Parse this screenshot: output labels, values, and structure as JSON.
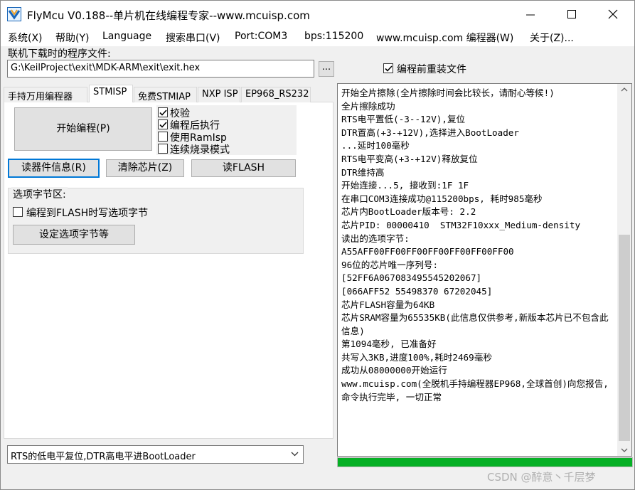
{
  "window": {
    "title": "FlyMcu V0.188--单片机在线编程专家--www.mcuisp.com",
    "icon": "flymcu-app-icon",
    "controls": [
      "minimize-icon",
      "maximize-icon",
      "close-icon"
    ]
  },
  "menu": [
    "系统(X)",
    "帮助(Y)",
    "Language",
    "搜索串口(V)",
    "Port:COM3",
    "bps:115200",
    "www.mcuisp.com 编程器(W)",
    "关于(Z)..."
  ],
  "program_file": {
    "label": "联机下载时的程序文件:",
    "path": "G:\\KeilProject\\exit\\MDK-ARM\\exit\\exit.hex",
    "browse_label": "...",
    "reload_label": "编程前重装文件",
    "reload_checked": true
  },
  "tabs": [
    "手持万用编程器",
    "STMISP",
    "免费STMIAP",
    "NXP ISP",
    "EP968_RS232"
  ],
  "active_tab": "STMISP",
  "stmisp": {
    "start_button": "开始编程(P)",
    "options": [
      {
        "label": "校验",
        "checked": true
      },
      {
        "label": "编程后执行",
        "checked": true
      },
      {
        "label": "使用RamIsp",
        "checked": false
      },
      {
        "label": "连续烧录模式",
        "checked": false
      }
    ],
    "read_info_button": "读器件信息(R)",
    "erase_button": "清除芯片(Z)",
    "read_flash_button": "读FLASH",
    "option_group_title": "选项字节区:",
    "flash_option_label": "编程到FLASH时写选项字节",
    "flash_option_checked": false,
    "set_option_button": "设定选项字节等"
  },
  "reset_mode": {
    "selected": "RTS的低电平复位,DTR高电平进BootLoader"
  },
  "log_lines": [
    "开始全片擦除(全片擦除时间会比较长，请耐心等候!)",
    "全片擦除成功",
    "RTS电平置低(-3--12V),复位",
    "DTR置高(+3-+12V),选择进入BootLoader",
    "...延时100毫秒",
    "RTS电平变高(+3-+12V)释放复位",
    "DTR维持高",
    "开始连接...5, 接收到:1F 1F",
    "在串口COM3连接成功@115200bps, 耗时985毫秒",
    "芯片内BootLoader版本号: 2.2",
    "芯片PID: 00000410  STM32F10xxx_Medium-density",
    "读出的选项字节:",
    "A55AFF00FF00FF00FF00FF00FF00FF00",
    "96位的芯片唯一序列号:",
    "[52FF6A067083495545202067]",
    "[066AFF52 55498370 67202045]",
    "芯片FLASH容量为64KB",
    "芯片SRAM容量为65535KB(此信息仅供参考,新版本芯片已不包含此信息)",
    "第1094毫秒, 已准备好",
    "共写入3KB,进度100%,耗时2469毫秒",
    "成功从08000000开始运行",
    "www.mcuisp.com(全脱机手持编程器EP968,全球首创)向您报告, 命令执行完毕, 一切正常"
  ],
  "progress": 1.0,
  "watermark": "CSDN @醉意丶千层梦",
  "colors": {
    "progress": "#06b025",
    "focus": "#0078d7",
    "button": "#e1e1e1"
  }
}
